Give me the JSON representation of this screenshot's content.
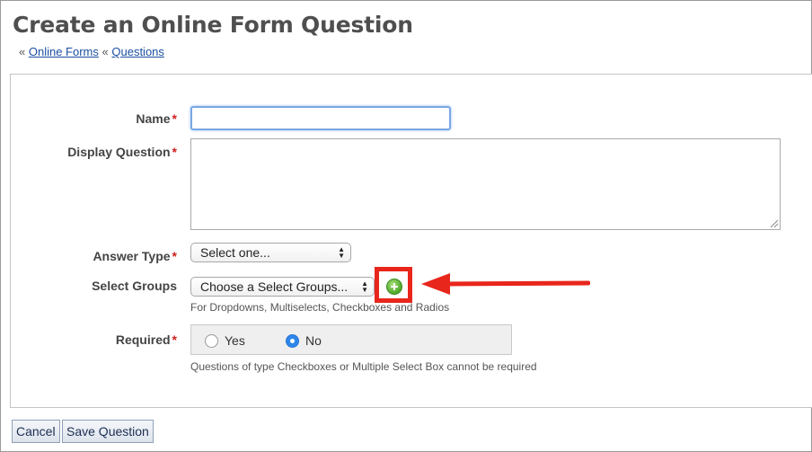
{
  "header": {
    "title": "Create an Online Form Question",
    "breadcrumb": {
      "sep1": "«",
      "link1": "Online Forms",
      "sep2": "«",
      "link2": "Questions"
    }
  },
  "form": {
    "name": {
      "label": "Name",
      "required_mark": "*",
      "value": ""
    },
    "display_question": {
      "label": "Display Question",
      "required_mark": "*",
      "value": ""
    },
    "answer_type": {
      "label": "Answer Type",
      "required_mark": "*",
      "selected": "Select one..."
    },
    "select_groups": {
      "label": "Select Groups",
      "selected": "Choose a Select Groups...",
      "help": "For Dropdowns, Multiselects, Checkboxes and Radios",
      "add_icon": "plus-circle-icon"
    },
    "required": {
      "label": "Required",
      "required_mark": "*",
      "options": [
        {
          "label": "Yes",
          "checked": false
        },
        {
          "label": "No",
          "checked": true
        }
      ],
      "help": "Questions of type Checkboxes or Multiple Select Box cannot be required"
    }
  },
  "annotation": {
    "highlight_color": "#e8261c"
  },
  "buttons": {
    "cancel": "Cancel",
    "save": "Save Question"
  },
  "colors": {
    "required_mark": "#d02020",
    "link": "#1a4fa0",
    "focus_border": "#79a7e4",
    "radio_checked": "#2f86ea",
    "add_icon": "#4ea72b"
  }
}
